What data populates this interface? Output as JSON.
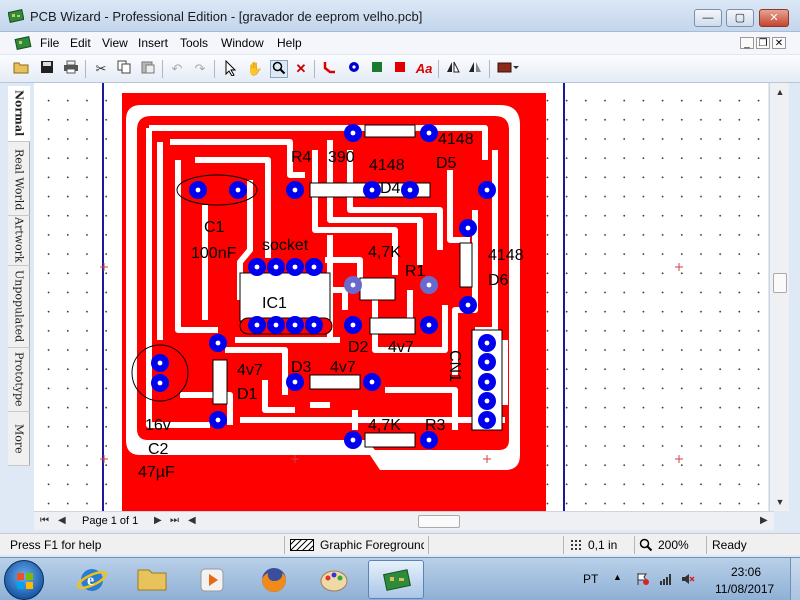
{
  "window": {
    "title": "PCB Wizard - Professional Edition - [gravador de eeprom velho.pcb]",
    "controls": {
      "minimize": "—",
      "maximize": "▢",
      "close": "✕"
    }
  },
  "menu": {
    "items": [
      "File",
      "Edit",
      "View",
      "Insert",
      "Tools",
      "Window",
      "Help"
    ]
  },
  "toolbar": {
    "buttons": [
      "open-icon",
      "save-icon",
      "print-icon",
      "cut-icon",
      "copy-icon",
      "paste-icon",
      "undo-icon",
      "redo-icon",
      "select-pointer-icon",
      "hand-icon",
      "zoom-icon",
      "delete-icon",
      "track-icon",
      "pad-icon",
      "copper-area-icon",
      "copper-fill-icon",
      "text-icon",
      "flip-icon",
      "mirror-icon",
      "component-gallery-icon"
    ],
    "text_tool_label": "Aa"
  },
  "view_tabs": [
    {
      "label": "Normal",
      "active": true
    },
    {
      "label": "Real World",
      "active": false
    },
    {
      "label": "Artwork",
      "active": false
    },
    {
      "label": "Unpopulated",
      "active": false
    },
    {
      "label": "Prototype",
      "active": false
    },
    {
      "label": "More",
      "active": false
    }
  ],
  "pcb": {
    "copper_color": "#ff0000",
    "pad_color": "#0000ee",
    "labels": {
      "r4": "R4",
      "r4_value": "390",
      "d4_value": "4148",
      "d4": "D4",
      "d5_value": "4148",
      "d5": "D5",
      "c1": "C1",
      "c1_value": "100nF",
      "socket": "socket",
      "r1_value": "4,7K",
      "r1": "R1",
      "d6_value": "4148",
      "d6": "D6",
      "ic1": "IC1",
      "d2": "D2",
      "d2_value": "4v7",
      "cn": "CN1",
      "d1_value": "4v7",
      "d1": "D1",
      "d3": "D3",
      "d3_value": "4v7",
      "c2_voltage": "16v",
      "c2": "C2",
      "c2_value": "47µF",
      "r3_value": "4,7K",
      "r3": "R3"
    }
  },
  "pagination": {
    "label": "Page 1 of 1"
  },
  "status": {
    "help": "Press F1 for help",
    "layer": "Graphic Foreground",
    "grid": "0,1 in",
    "zoom": "200%",
    "state": "Ready"
  },
  "taskbar": {
    "language": "PT",
    "time": "23:06",
    "date": "11/08/2017"
  }
}
